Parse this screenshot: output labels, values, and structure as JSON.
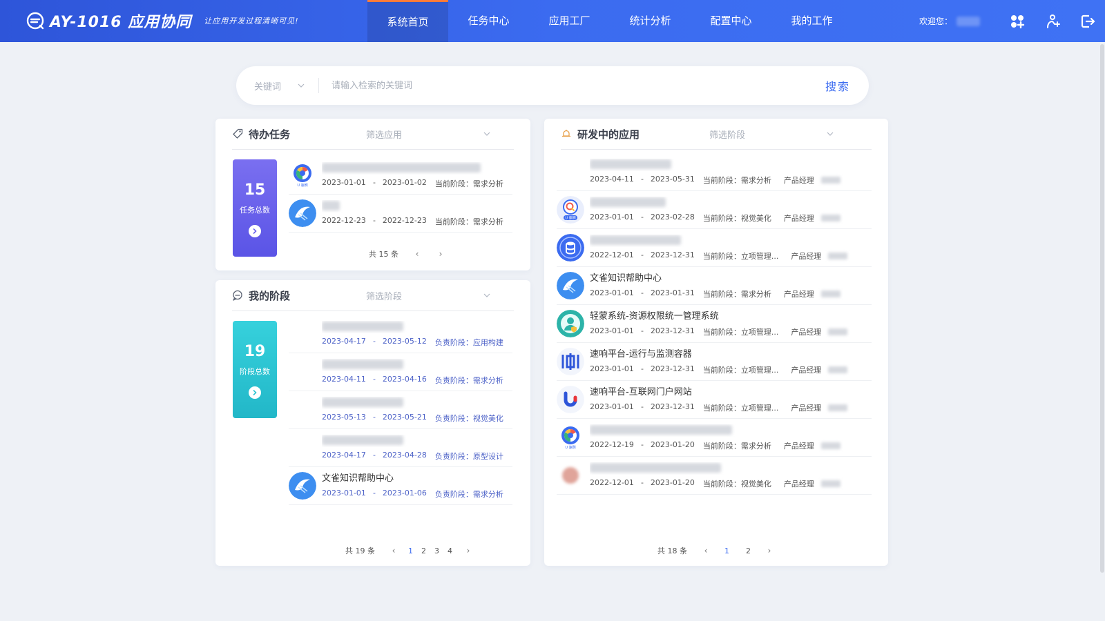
{
  "header": {
    "title": "AY-1016 应用协同",
    "slogan": "让应用开发过程清晰可见!",
    "nav": [
      {
        "label": "系统首页",
        "active": true
      },
      {
        "label": "任务中心"
      },
      {
        "label": "应用工厂"
      },
      {
        "label": "统计分析"
      },
      {
        "label": "配置中心"
      },
      {
        "label": "我的工作"
      }
    ],
    "welcome": "欢迎您："
  },
  "search": {
    "select_label": "关键词",
    "placeholder": "请输入检索的关键词",
    "button": "搜索"
  },
  "tasks": {
    "title": "待办任务",
    "filter": "筛选应用",
    "count": "15",
    "count_label": "任务总数",
    "items": [
      {
        "start": "2023-01-01",
        "end": "2023-01-02",
        "stage": "当前阶段：需求分析",
        "icon": "chrome-ball-icon"
      },
      {
        "start": "2022-12-23",
        "end": "2022-12-23",
        "stage": "当前阶段：需求分析",
        "icon": "bird-icon"
      }
    ],
    "pager_total": "共 15 条"
  },
  "stages": {
    "title": "我的阶段",
    "filter": "筛选阶段",
    "count": "19",
    "count_label": "阶段总数",
    "items": [
      {
        "name": "",
        "start": "2023-04-17",
        "end": "2023-05-12",
        "stage": "负责阶段：应用构建",
        "icon": ""
      },
      {
        "name": "",
        "start": "2023-04-11",
        "end": "2023-04-16",
        "stage": "负责阶段：需求分析",
        "icon": ""
      },
      {
        "name": "",
        "start": "2023-05-13",
        "end": "2023-05-21",
        "stage": "负责阶段：视觉美化",
        "icon": ""
      },
      {
        "name": "",
        "start": "2023-04-17",
        "end": "2023-04-28",
        "stage": "负责阶段：原型设计",
        "icon": ""
      },
      {
        "name": "文雀知识帮助中心",
        "start": "2023-01-01",
        "end": "2023-01-06",
        "stage": "负责阶段：需求分析",
        "icon": "bird-icon"
      }
    ],
    "pager_total": "共 19 条",
    "pages": [
      "1",
      "2",
      "3",
      "4"
    ]
  },
  "apps": {
    "title": "研发中的应用",
    "filter": "筛选阶段",
    "owner_label": "产品经理",
    "items": [
      {
        "name": "",
        "start": "2023-04-11",
        "end": "2023-05-31",
        "stage": "当前阶段：需求分析",
        "icon": ""
      },
      {
        "name": "",
        "start": "2023-01-01",
        "end": "2023-02-28",
        "stage": "当前阶段：视觉美化",
        "icon": "search-ball-icon"
      },
      {
        "name": "",
        "start": "2022-12-01",
        "end": "2023-12-31",
        "stage": "当前阶段：立项管理...",
        "icon": "database-icon"
      },
      {
        "name": "文雀知识帮助中心",
        "start": "2023-01-01",
        "end": "2023-01-31",
        "stage": "当前阶段：需求分析",
        "icon": "bird-icon"
      },
      {
        "name": "轻蒙系统-资源权限统一管理系统",
        "start": "2023-01-01",
        "end": "2023-12-31",
        "stage": "当前阶段：立项管理...",
        "icon": "user-shield-icon"
      },
      {
        "name": "速响平台-运行与监测容器",
        "start": "2023-01-01",
        "end": "2023-12-31",
        "stage": "当前阶段：立项管理...",
        "icon": "bracket-logo-icon"
      },
      {
        "name": "速响平台-互联网门户网站",
        "start": "2023-01-01",
        "end": "2023-12-31",
        "stage": "当前阶段：立项管理...",
        "icon": "u-logo-icon"
      },
      {
        "name": "",
        "start": "2022-12-19",
        "end": "2023-01-20",
        "stage": "当前阶段：需求分析",
        "icon": "chrome-ball-icon"
      },
      {
        "name": "",
        "start": "2022-12-01",
        "end": "2023-01-20",
        "stage": "当前阶段：视觉美化",
        "icon": "red-blur-icon"
      }
    ],
    "pager_total": "共 18 条",
    "pages": [
      "1",
      "2"
    ]
  },
  "colors": {
    "header": "#3b6bf0",
    "accent": "#3b6bf0",
    "nav_active_top": "#ff7b3a",
    "stat_purple": "#6a62ec",
    "stat_cyan": "#2cc4d2",
    "stage_blue": "#4e63c8"
  }
}
